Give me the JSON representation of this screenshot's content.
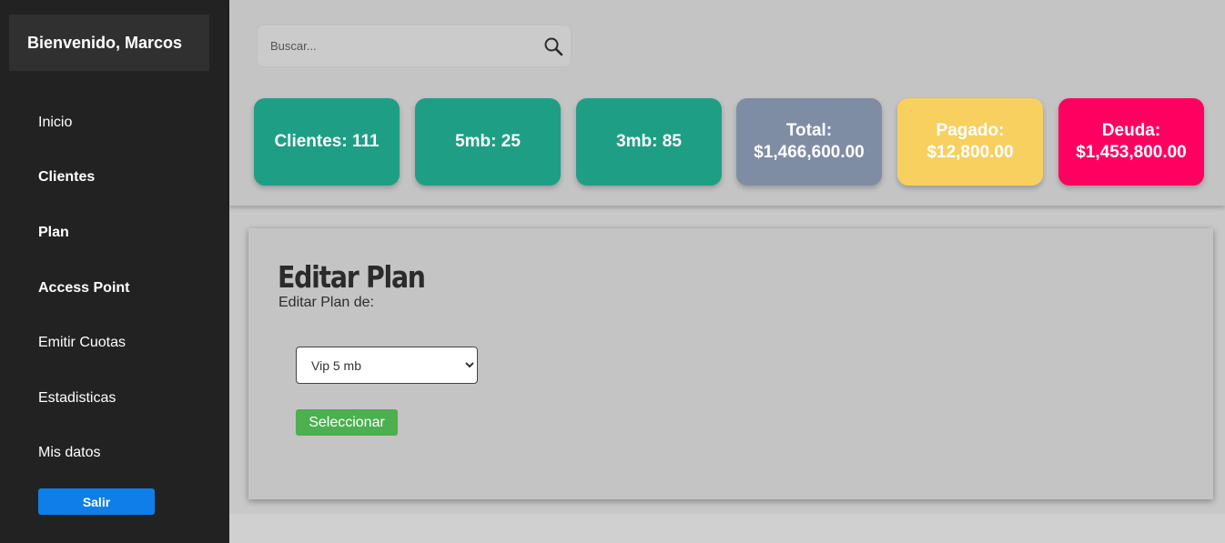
{
  "sidebar": {
    "welcome": "Bienvenido, Marcos",
    "items": [
      {
        "label": "Inicio"
      },
      {
        "label": "Clientes"
      },
      {
        "label": "Plan"
      },
      {
        "label": "Access Point"
      },
      {
        "label": "Emitir Cuotas"
      },
      {
        "label": "Estadisticas"
      },
      {
        "label": "Mis datos"
      }
    ],
    "logout_label": "Salir"
  },
  "search": {
    "placeholder": "Buscar...",
    "icon": "search-icon"
  },
  "stats": [
    {
      "label": "Clientes: 111",
      "color": "#1e9e85"
    },
    {
      "label": "5mb: 25",
      "color": "#1e9e85"
    },
    {
      "label": "3mb: 85",
      "color": "#1e9e85"
    },
    {
      "label": "Total: $1,466,600.00",
      "color": "#7f8da4"
    },
    {
      "label": "Pagado: $12,800.00",
      "color": "#f8d060"
    },
    {
      "label": "Deuda: $1,453,800.00",
      "color": "#ff0060"
    }
  ],
  "panel": {
    "title": "Editar Plan",
    "subtitle": "Editar Plan de:",
    "select_value": "Vip 5 mb",
    "button_label": "Seleccionar"
  },
  "colors": {
    "sidebar_bg": "#222222",
    "accent_blue": "#0f7ee8",
    "button_green": "#4caf50"
  }
}
